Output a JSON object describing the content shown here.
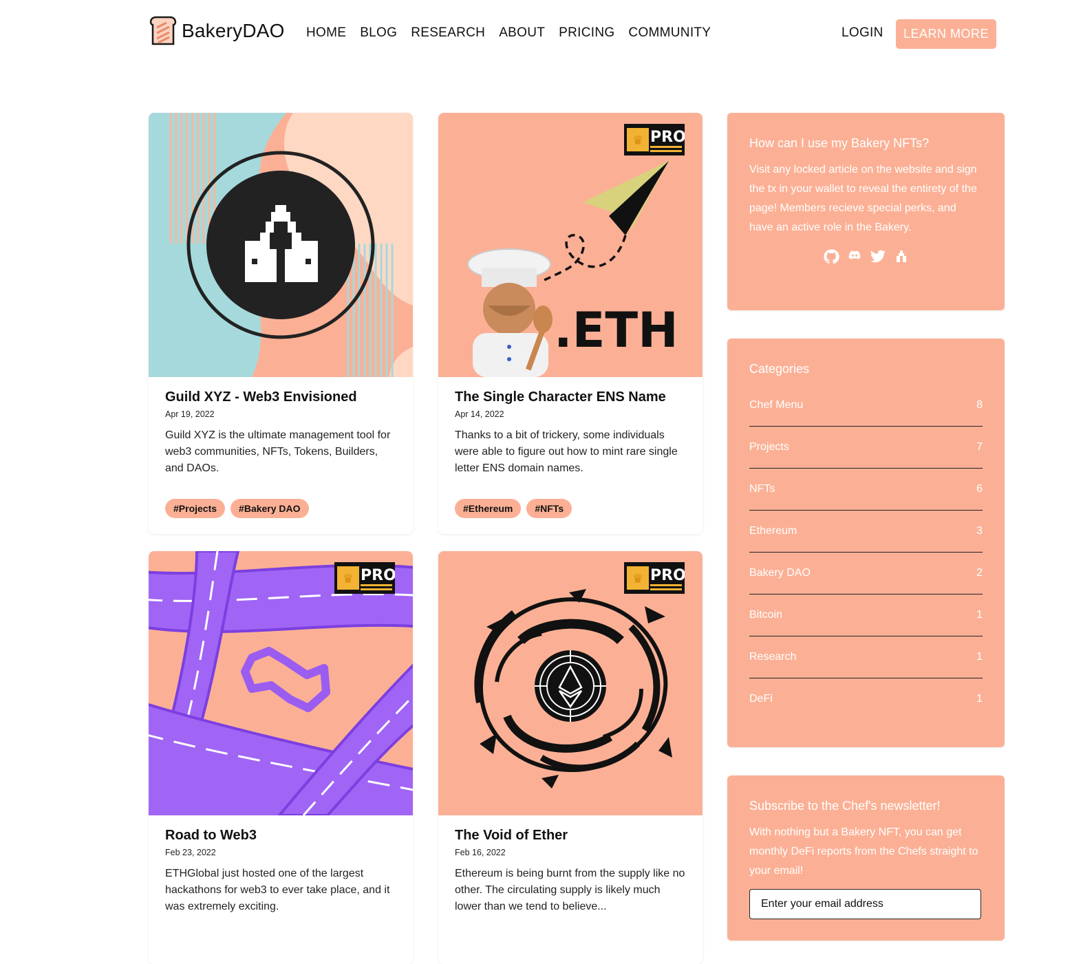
{
  "header": {
    "brand": "BakeryDAO",
    "nav": [
      "HOME",
      "BLOG",
      "RESEARCH",
      "ABOUT",
      "PRICING",
      "COMMUNITY"
    ],
    "login": "LOGIN",
    "cta": "LEARN MORE",
    "accent_color": "#fbb095"
  },
  "posts": [
    {
      "title": "Guild XYZ - Web3 Envisioned",
      "date": "Apr 19, 2022",
      "description": "Guild XYZ is the ultimate management tool for web3 communities, NFTs, Tokens, Builders, and DAOs.",
      "tags": [
        "#Projects",
        "#Bakery DAO"
      ],
      "pro": false
    },
    {
      "title": "The Single Character ENS Name",
      "date": "Apr 14, 2022",
      "description": "Thanks to a bit of trickery, some individuals were able to figure out how to mint rare single letter ENS domain names.",
      "tags": [
        "#Ethereum",
        "#NFTs"
      ],
      "pro": true,
      "image_text": ".ETH"
    },
    {
      "title": "Road to Web3",
      "date": "Feb 23, 2022",
      "description": "ETHGlobal just hosted one of the largest hackathons for web3 to ever take place, and it was extremely exciting.",
      "pro": true
    },
    {
      "title": "The Void of Ether",
      "date": "Feb 16, 2022",
      "description": "Ethereum is being burnt from the supply like no other. The circulating supply is likely much lower than we tend to believe...",
      "pro": true
    }
  ],
  "pro_badge": "PRO",
  "sidebar": {
    "nft_info": {
      "title": "How can I use my Bakery NFTs?",
      "body": "Visit any locked article on the website and sign the tx in your wallet to reveal the entirety of the page! Members recieve special perks, and have an active role in the Bakery.",
      "social_icons": [
        "github-icon",
        "discord-icon",
        "twitter-icon",
        "guild-icon"
      ]
    },
    "categories": {
      "title": "Categories",
      "items": [
        {
          "name": "Chef Menu",
          "count": "8"
        },
        {
          "name": "Projects",
          "count": "7"
        },
        {
          "name": "NFTs",
          "count": "6"
        },
        {
          "name": "Ethereum",
          "count": "3"
        },
        {
          "name": "Bakery DAO",
          "count": "2"
        },
        {
          "name": "Bitcoin",
          "count": "1"
        },
        {
          "name": "Research",
          "count": "1"
        },
        {
          "name": "DeFi",
          "count": "1"
        }
      ]
    },
    "newsletter": {
      "title": "Subscribe to the Chef's newsletter!",
      "body": "With nothing but a Bakery NFT, you can get monthly DeFi reports from the Chefs straight to your email!",
      "placeholder": "Enter your email address"
    }
  }
}
